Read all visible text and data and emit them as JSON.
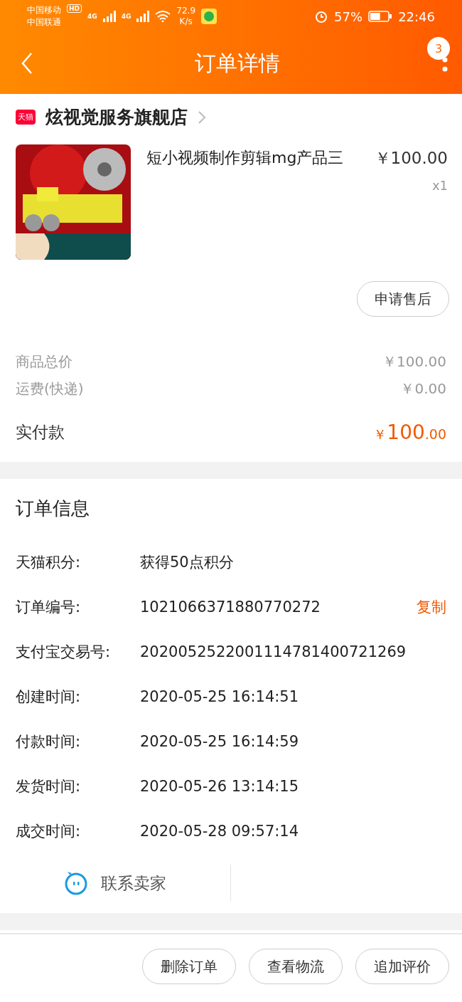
{
  "status_bar": {
    "carriers": [
      "中国移动",
      "中国联通"
    ],
    "hd": "HD",
    "networks": [
      "4G",
      "4G"
    ],
    "speed": "72.9",
    "speed_unit": "K/s",
    "battery": "57%",
    "time": "22:46"
  },
  "header": {
    "title": "订单详情",
    "badge": "3"
  },
  "shop": {
    "badge": "天猫",
    "name": "炫视觉服务旗舰店"
  },
  "product": {
    "name": "短小视频制作剪辑mg产品三",
    "price": "￥100.00",
    "quantity": "x1",
    "action": "申请售后"
  },
  "costs": [
    {
      "label": "商品总价",
      "value": "￥100.00"
    },
    {
      "label": "运费(快递)",
      "value": "￥0.00"
    }
  ],
  "total": {
    "label": "实付款",
    "currency": "￥",
    "integer": "100",
    "decimal": ".00"
  },
  "order_info": {
    "title": "订单信息",
    "rows": [
      {
        "label": "天猫积分:",
        "value": "获得50点积分"
      },
      {
        "label": "订单编号:",
        "value": "1021066371880770272",
        "action": "复制"
      },
      {
        "label": "支付宝交易号:",
        "value": "2020052522001114781400721269"
      },
      {
        "label": "创建时间:",
        "value": "2020-05-25 16:14:51"
      },
      {
        "label": "付款时间:",
        "value": "2020-05-25 16:14:59"
      },
      {
        "label": "发货时间:",
        "value": "2020-05-26 13:14:15"
      },
      {
        "label": "成交时间:",
        "value": "2020-05-28 09:57:14"
      }
    ],
    "contact": "联系卖家"
  },
  "bottom_actions": [
    "删除订单",
    "查看物流",
    "追加评价"
  ]
}
